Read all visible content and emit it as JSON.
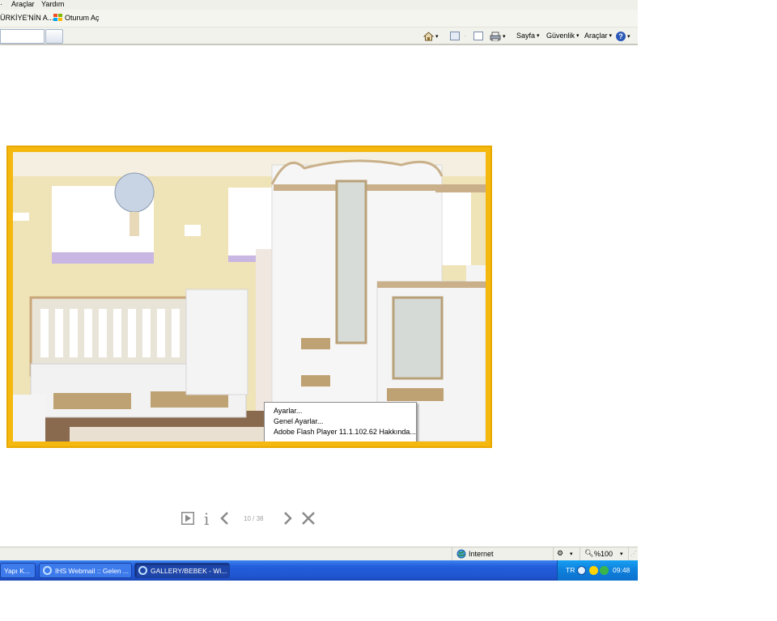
{
  "menubar": {
    "items": [
      "Araçlar",
      "Yardım"
    ]
  },
  "favorites": {
    "items": [
      {
        "label": "ÜRKİYE'NİN A...",
        "icon": "ie-page-icon"
      },
      {
        "label": "Oturum Aç",
        "icon": "windows-live-icon"
      }
    ]
  },
  "commandbar": {
    "items": [
      {
        "label": "Sayfa",
        "icon": "page-icon"
      },
      {
        "label": "Güvenlik",
        "icon": ""
      },
      {
        "label": "Araçlar",
        "icon": ""
      }
    ]
  },
  "context_menu": {
    "items": [
      "Ayarlar...",
      "Genel Ayarlar...",
      "Adobe Flash Player 11.1.102.62 Hakkında..."
    ]
  },
  "viewer": {
    "counter": "10 / 38",
    "info_glyph": "i"
  },
  "statusbar": {
    "zone": "Internet",
    "zoom": "%100"
  },
  "taskbar": {
    "buttons": [
      {
        "label": "Yapı K...",
        "active": false
      },
      {
        "label": "IHS Webmail :: Gelen ...",
        "active": false
      },
      {
        "label": "GALLERY/BEBEK - Wi...",
        "active": true
      }
    ],
    "tray": {
      "lang": "TR",
      "clock": "09:48"
    }
  },
  "colors": {
    "frame": "#f5b80f",
    "taskbar": "#245edb",
    "tray": "#0f84e0"
  }
}
